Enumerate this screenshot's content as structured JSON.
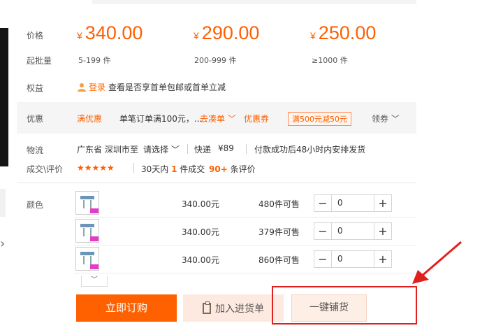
{
  "labels": {
    "price": "价格",
    "min_order": "起批量",
    "rights": "权益",
    "promo": "优惠",
    "logistics": "物流",
    "deals": "成交\\评价",
    "color": "颜色"
  },
  "prices": [
    {
      "currency": "¥",
      "amount": "340.00",
      "range": "5-199 件"
    },
    {
      "currency": "¥",
      "amount": "290.00",
      "range": "200-999 件"
    },
    {
      "currency": "¥",
      "amount": "250.00",
      "range": "≥1000 件"
    }
  ],
  "rights": {
    "login": "登录",
    "text": "查看是否享首单包邮或首单立减"
  },
  "promo": {
    "tag": "满优惠",
    "desc": "单笔订单满100元，...",
    "link": "去凑单",
    "coupon_title": "优惠券",
    "coupon": "满500元减50元",
    "claim": "领券"
  },
  "logistics": {
    "origin": "广东省 深圳市",
    "to": "至",
    "dest": "请选择",
    "method": "快递",
    "fee": "¥89",
    "note": "付款成功后48小时内安排发货"
  },
  "deals": {
    "stars": "★★★★★",
    "sales_prefix": "30天内",
    "sales_count": "1",
    "sales_suffix": "件成交",
    "reviews_count": "90+",
    "reviews_suffix": "条评价"
  },
  "skus": [
    {
      "price": "340.00元",
      "stock": "480件可售",
      "qty": "0"
    },
    {
      "price": "340.00元",
      "stock": "379件可售",
      "qty": "0"
    },
    {
      "price": "340.00元",
      "stock": "860件可售",
      "qty": "0"
    }
  ],
  "stepper": {
    "minus": "−",
    "plus": "+"
  },
  "buttons": {
    "order": "立即订购",
    "add_purchase": "加入进货单",
    "one_key": "一键铺货"
  },
  "icons": {
    "chevron": "chevron-down-icon",
    "arrow_color": "#e0201f"
  }
}
